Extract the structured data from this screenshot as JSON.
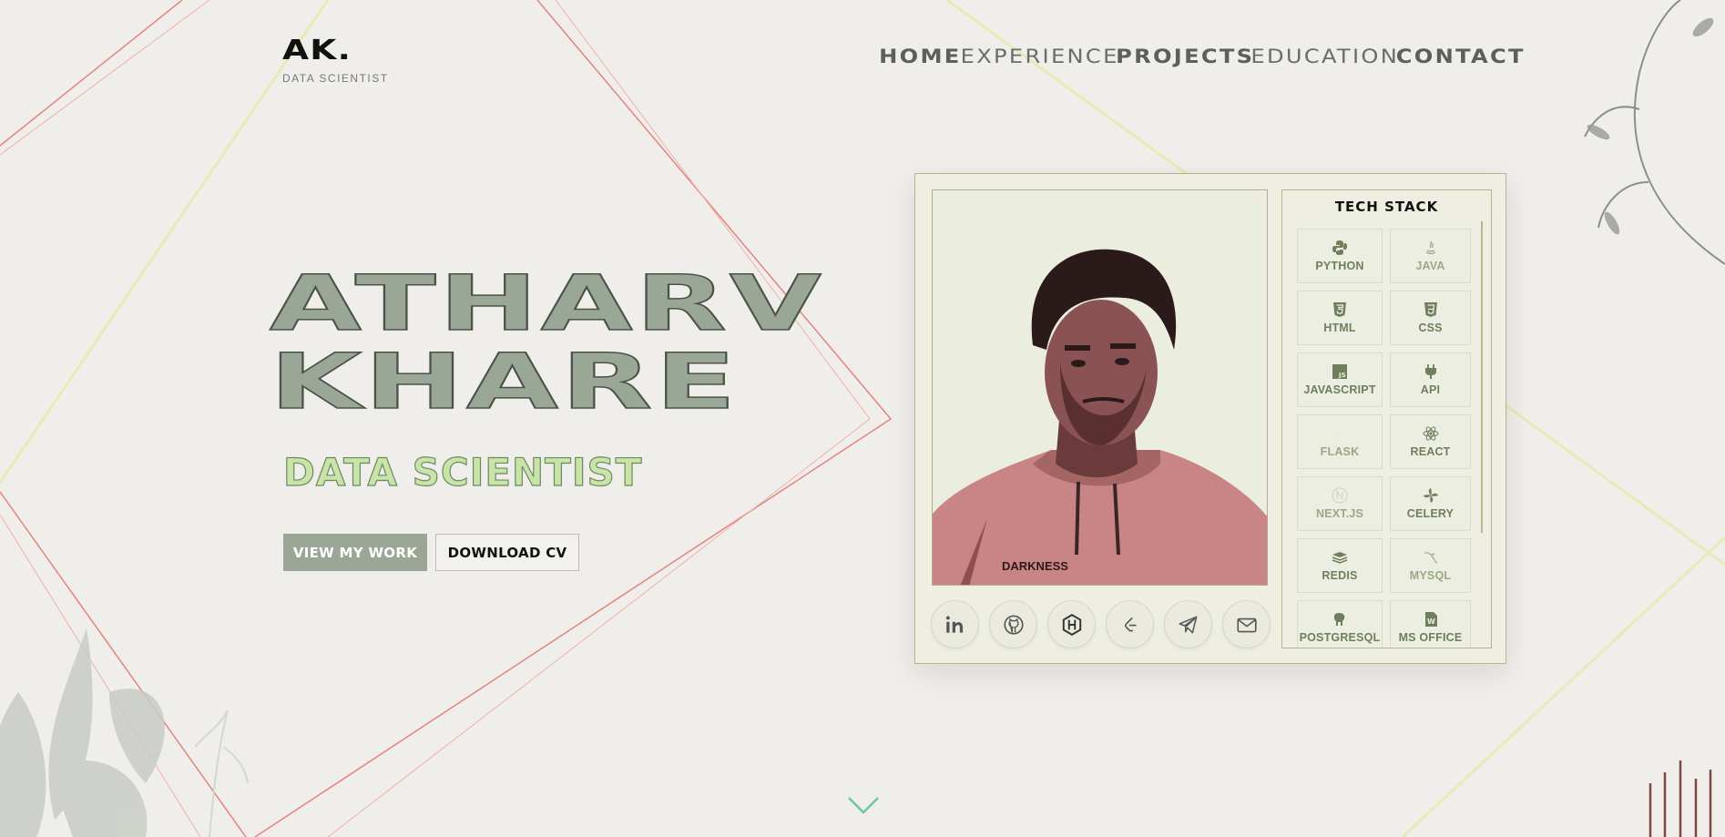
{
  "header": {
    "logo": "AK.",
    "logo_subtitle": "DATA SCIENTIST",
    "nav": [
      {
        "label": "HOME"
      },
      {
        "label": "EXPERIENCE"
      },
      {
        "label": "PROJECTS"
      },
      {
        "label": "EDUCATION"
      },
      {
        "label": "CONTACT"
      }
    ]
  },
  "hero": {
    "first_name": "ATHARV",
    "last_name": "KHARE",
    "role": "DATA SCIENTIST",
    "primary_button": "VIEW MY WORK",
    "secondary_button": "DOWNLOAD CV"
  },
  "card": {
    "photo_shirt_text": "DARKNESS",
    "socials": [
      {
        "icon": "linkedin-icon"
      },
      {
        "icon": "github-icon"
      },
      {
        "icon": "hashnode-icon"
      },
      {
        "icon": "leetcode-icon"
      },
      {
        "icon": "telegram-icon"
      },
      {
        "icon": "mail-icon"
      }
    ],
    "tech_stack": {
      "title": "TECH STACK",
      "items": [
        {
          "label": "PYTHON",
          "icon": "python-icon"
        },
        {
          "label": "JAVA",
          "icon": "java-icon"
        },
        {
          "label": "HTML",
          "icon": "html-icon"
        },
        {
          "label": "CSS",
          "icon": "css-icon"
        },
        {
          "label": "JAVASCRIPT",
          "icon": "javascript-icon"
        },
        {
          "label": "API",
          "icon": "api-plug-icon"
        },
        {
          "label": "FLASK",
          "icon": "flask-icon"
        },
        {
          "label": "REACT",
          "icon": "react-icon"
        },
        {
          "label": "NEXT.JS",
          "icon": "nextjs-icon"
        },
        {
          "label": "CELERY",
          "icon": "celery-icon"
        },
        {
          "label": "REDIS",
          "icon": "redis-icon"
        },
        {
          "label": "MYSQL",
          "icon": "mysql-icon"
        },
        {
          "label": "POSTGRESQL",
          "icon": "postgresql-icon"
        },
        {
          "label": "MS OFFICE",
          "icon": "ms-office-icon"
        }
      ]
    }
  },
  "colors": {
    "background": "#efeeea",
    "accent": "#9aa797",
    "role_fill": "#c8e4a8",
    "tech_label": "#6f7f5e",
    "line_red": "#e5837f",
    "line_yellow": "#e6ebb8",
    "chevron": "#6fc7a1"
  }
}
